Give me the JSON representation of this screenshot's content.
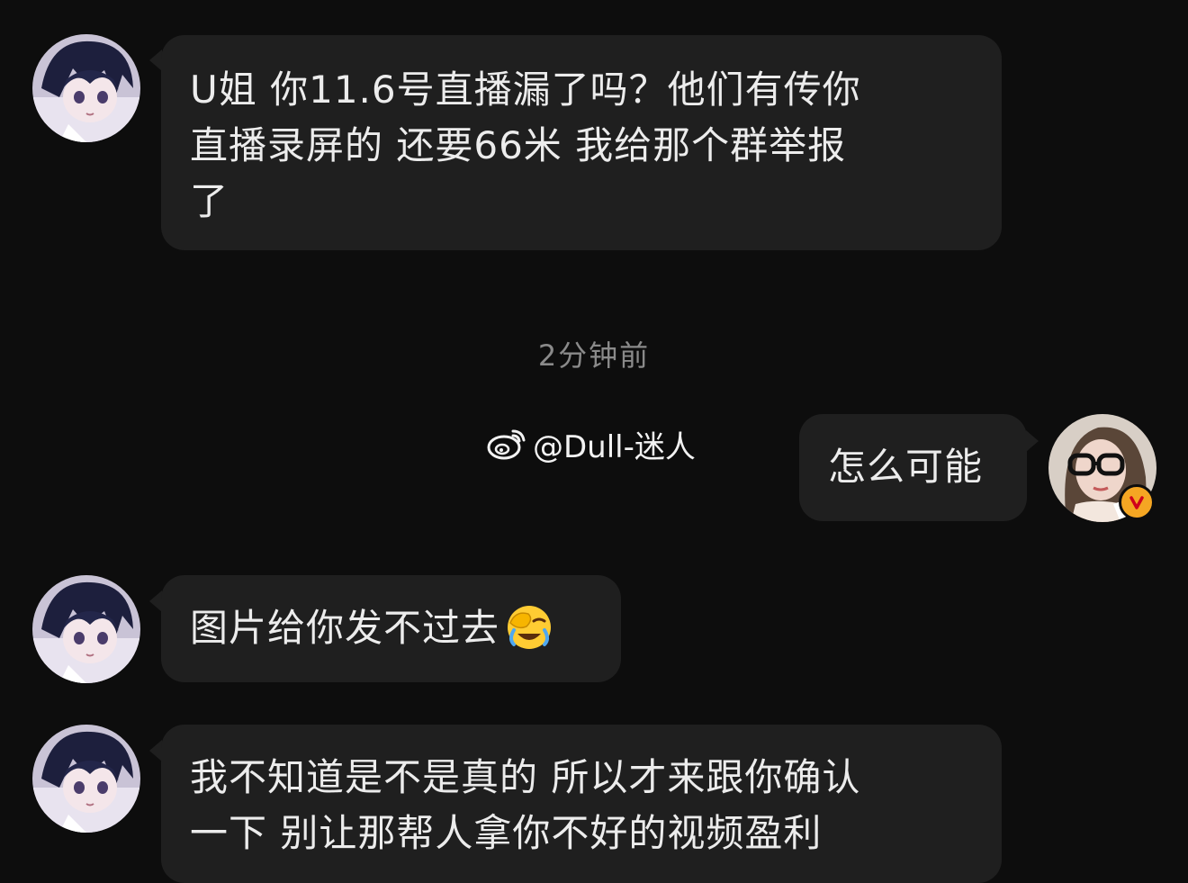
{
  "messages": [
    {
      "sender": "other",
      "text_line1": "U姐  你11.6号直播漏了吗？他们有传你",
      "text_line2": "直播录屏的  还要66米  我给那个群举报",
      "text_line3": "了"
    },
    {
      "sender": "self",
      "text": "怎么可能"
    },
    {
      "sender": "other",
      "text": "图片给你发不过去",
      "emoji": "facepalm-laughing-emoji"
    },
    {
      "sender": "other",
      "text_line1": "我不知道是不是真的  所以才来跟你确认",
      "text_line2": "一下  别让那帮人拿你不好的视频盈利"
    }
  ],
  "timestamp": "2分钟前",
  "watermark": {
    "icon": "weibo-logo-icon",
    "text": "@Dull-迷人"
  },
  "self_badge": {
    "label": "V",
    "color": "#f5a623"
  },
  "colors": {
    "background": "#0d0d0d",
    "bubble": "#1f1f1f",
    "text": "#ececec",
    "timestamp": "#8a8a8a"
  }
}
